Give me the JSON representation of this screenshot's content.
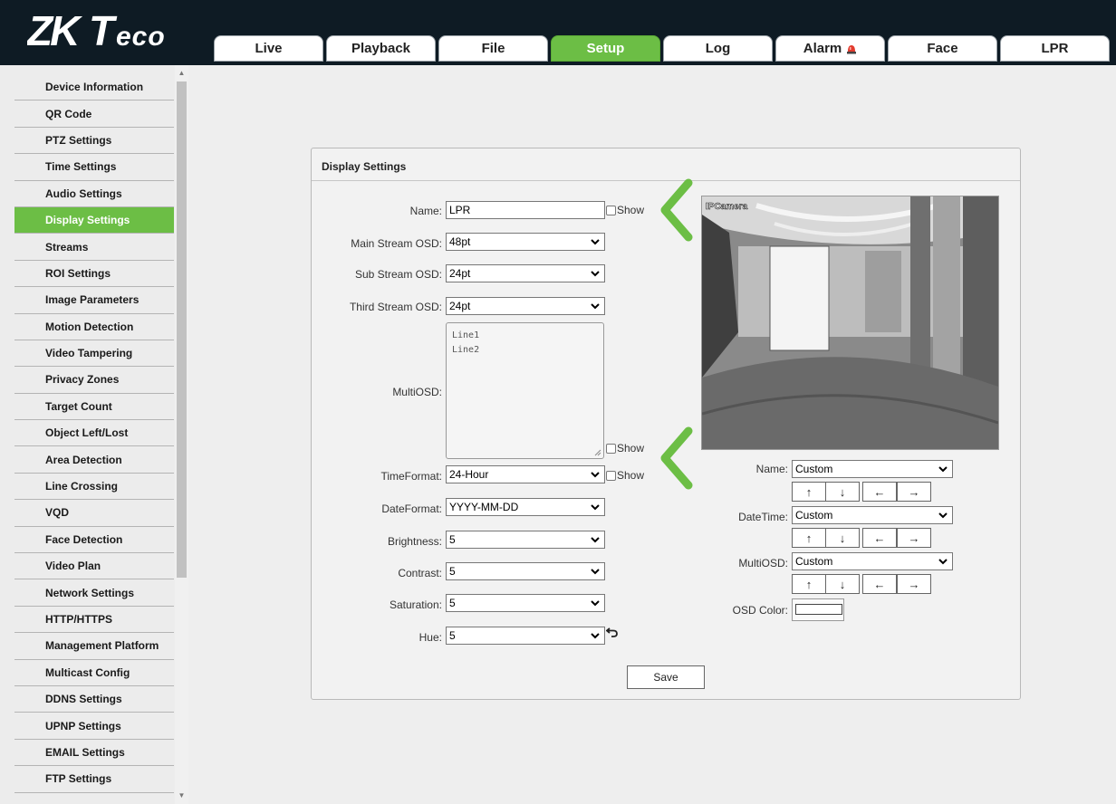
{
  "brand": {
    "logo_text": "ZKTeco",
    "accent": "#6cbe45",
    "header_bg": "#0e1b24"
  },
  "tabs": [
    {
      "label": "Live"
    },
    {
      "label": "Playback"
    },
    {
      "label": "File"
    },
    {
      "label": "Setup",
      "active": true
    },
    {
      "label": "Log"
    },
    {
      "label": "Alarm",
      "icon": "alarm-light-icon"
    },
    {
      "label": "Face"
    },
    {
      "label": "LPR"
    }
  ],
  "sidebar": {
    "items": [
      {
        "label": "Device Information"
      },
      {
        "label": "QR Code"
      },
      {
        "label": "PTZ Settings"
      },
      {
        "label": "Time Settings"
      },
      {
        "label": "Audio Settings"
      },
      {
        "label": "Display Settings",
        "active": true
      },
      {
        "label": "Streams"
      },
      {
        "label": "ROI Settings"
      },
      {
        "label": "Image Parameters"
      },
      {
        "label": "Motion Detection"
      },
      {
        "label": "Video Tampering"
      },
      {
        "label": "Privacy Zones"
      },
      {
        "label": "Target Count"
      },
      {
        "label": "Object Left/Lost"
      },
      {
        "label": "Area Detection"
      },
      {
        "label": "Line Crossing"
      },
      {
        "label": "VQD"
      },
      {
        "label": "Face Detection"
      },
      {
        "label": "Video Plan"
      },
      {
        "label": "Network Settings"
      },
      {
        "label": "HTTP/HTTPS"
      },
      {
        "label": "Management Platform"
      },
      {
        "label": "Multicast Config"
      },
      {
        "label": "DDNS Settings"
      },
      {
        "label": "UPNP Settings"
      },
      {
        "label": "EMAIL Settings"
      },
      {
        "label": "FTP Settings"
      }
    ]
  },
  "panel": {
    "title": "Display Settings",
    "name": {
      "label": "Name:",
      "value": "LPR",
      "show_label": "Show"
    },
    "main_stream_osd": {
      "label": "Main Stream OSD:",
      "value": "48pt"
    },
    "sub_stream_osd": {
      "label": "Sub Stream OSD:",
      "value": "24pt"
    },
    "third_stream_osd": {
      "label": "Third Stream OSD:",
      "value": "24pt"
    },
    "multiosd": {
      "label": "MultiOSD:",
      "lines": [
        "Line1",
        "Line2"
      ],
      "show_label": "Show"
    },
    "time_format": {
      "label": "TimeFormat:",
      "value": "24-Hour",
      "show_label": "Show"
    },
    "date_format": {
      "label": "DateFormat:",
      "value": "YYYY-MM-DD"
    },
    "brightness": {
      "label": "Brightness:",
      "value": "5"
    },
    "contrast": {
      "label": "Contrast:",
      "value": "5"
    },
    "saturation": {
      "label": "Saturation:",
      "value": "5"
    },
    "hue": {
      "label": "Hue:",
      "value": "5"
    },
    "save_label": "Save",
    "preview": {
      "overlay_text": "IPCamera"
    },
    "pos_name": {
      "label": "Name:",
      "value": "Custom"
    },
    "pos_datetime": {
      "label": "DateTime:",
      "value": "Custom"
    },
    "pos_multiosd": {
      "label": "MultiOSD:",
      "value": "Custom"
    },
    "arrows": {
      "up": "↑",
      "down": "↓",
      "left": "←",
      "right": "→"
    },
    "osd_color": {
      "label": "OSD Color:",
      "value": "#ffffff"
    }
  }
}
